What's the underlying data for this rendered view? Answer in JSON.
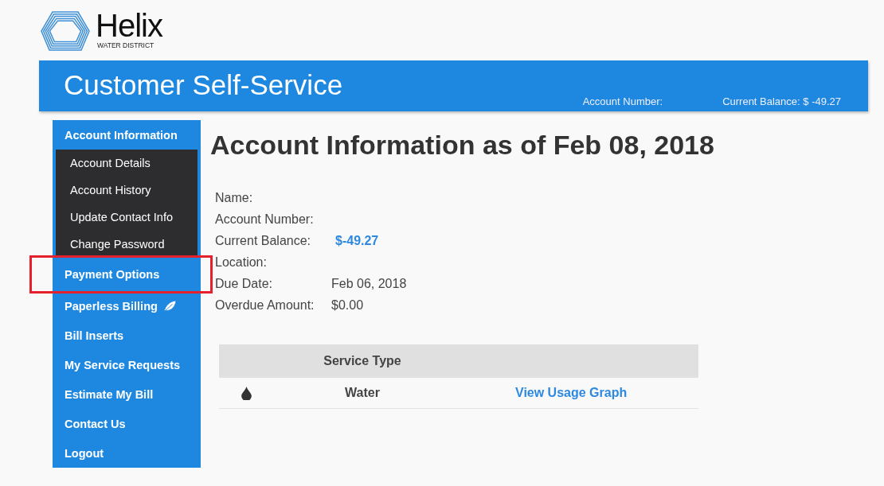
{
  "logo": {
    "name": "Helix",
    "tagline": "WATER DISTRICT"
  },
  "header": {
    "title": "Customer Self-Service",
    "account_number": "Account Number:",
    "balance": "Current Balance: $ -49.27"
  },
  "sidebar": {
    "items": [
      {
        "label": "Account Information",
        "kind": "header",
        "highlighted": false
      },
      {
        "label": "Account Details",
        "kind": "sub",
        "highlighted": false
      },
      {
        "label": "Account History",
        "kind": "sub",
        "highlighted": false
      },
      {
        "label": "Update Contact Info",
        "kind": "sub",
        "highlighted": false
      },
      {
        "label": "Change Password",
        "kind": "sub",
        "highlighted": false
      },
      {
        "label": "Payment Options",
        "kind": "main",
        "highlighted": true
      },
      {
        "label": "Paperless Billing",
        "kind": "leaf",
        "highlighted": false
      },
      {
        "label": "Bill Inserts",
        "kind": "main",
        "highlighted": false
      },
      {
        "label": "My Service Requests",
        "kind": "main",
        "highlighted": false
      },
      {
        "label": "Estimate My Bill",
        "kind": "main",
        "highlighted": false
      },
      {
        "label": "Contact Us",
        "kind": "main",
        "highlighted": false
      },
      {
        "label": "Logout",
        "kind": "main",
        "highlighted": false
      }
    ]
  },
  "main": {
    "title": "Account Information as of Feb 08, 2018",
    "details": [
      {
        "label": "Name:"
      },
      {
        "label": "Account Number:"
      },
      {
        "label": "Current Balance:",
        "value": "$-49.27",
        "kind": "money"
      },
      {
        "label": "Location:"
      },
      {
        "label": "Due Date:",
        "value": "Feb 06, 2018"
      },
      {
        "label": "Overdue Amount:",
        "value": "$0.00"
      }
    ],
    "table": {
      "columns": [
        "Service Type"
      ],
      "rows": [
        {
          "service_type": "Water",
          "link": "View Usage Graph"
        }
      ]
    }
  }
}
